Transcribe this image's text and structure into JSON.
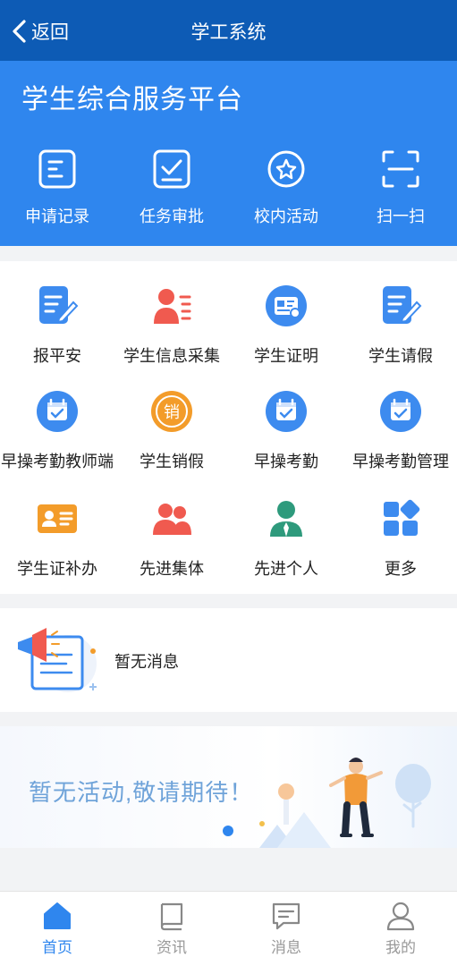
{
  "header": {
    "back_label": "返回",
    "title": "学工系统"
  },
  "hero": {
    "title": "学生综合服务平台",
    "quick_actions": [
      {
        "label": "申请记录",
        "icon": "application-record-icon"
      },
      {
        "label": "任务审批",
        "icon": "task-approval-icon"
      },
      {
        "label": "校内活动",
        "icon": "campus-activity-icon"
      },
      {
        "label": "扫一扫",
        "icon": "scan-icon"
      }
    ]
  },
  "services": [
    {
      "label": "报平安",
      "icon": "report-safe-icon"
    },
    {
      "label": "学生信息采集",
      "icon": "info-collection-icon"
    },
    {
      "label": "学生证明",
      "icon": "certificate-icon"
    },
    {
      "label": "学生请假",
      "icon": "leave-request-icon"
    },
    {
      "label": "早操考勤教师端",
      "icon": "calendar-check-icon"
    },
    {
      "label": "学生销假",
      "icon": "cancel-leave-icon"
    },
    {
      "label": "早操考勤",
      "icon": "calendar-check-icon"
    },
    {
      "label": "早操考勤管理",
      "icon": "calendar-check-icon"
    },
    {
      "label": "学生证补办",
      "icon": "id-card-icon"
    },
    {
      "label": "先进集体",
      "icon": "group-icon"
    },
    {
      "label": "先进个人",
      "icon": "person-icon"
    },
    {
      "label": "更多",
      "icon": "more-apps-icon"
    }
  ],
  "notice": {
    "text": "暂无消息"
  },
  "banner": {
    "text": "暂无活动,敬请期待！"
  },
  "tabbar": [
    {
      "label": "首页",
      "icon": "home-icon",
      "active": true
    },
    {
      "label": "资讯",
      "icon": "news-icon",
      "active": false
    },
    {
      "label": "消息",
      "icon": "message-icon",
      "active": false
    },
    {
      "label": "我的",
      "icon": "profile-icon",
      "active": false
    }
  ],
  "colors": {
    "header_bg": "#0d5bb5",
    "hero_bg": "#2f86ee",
    "accent": "#2f86ee",
    "red_icon": "#f05a4f",
    "orange_icon": "#f39c2a",
    "green_icon": "#2e9a7c"
  }
}
